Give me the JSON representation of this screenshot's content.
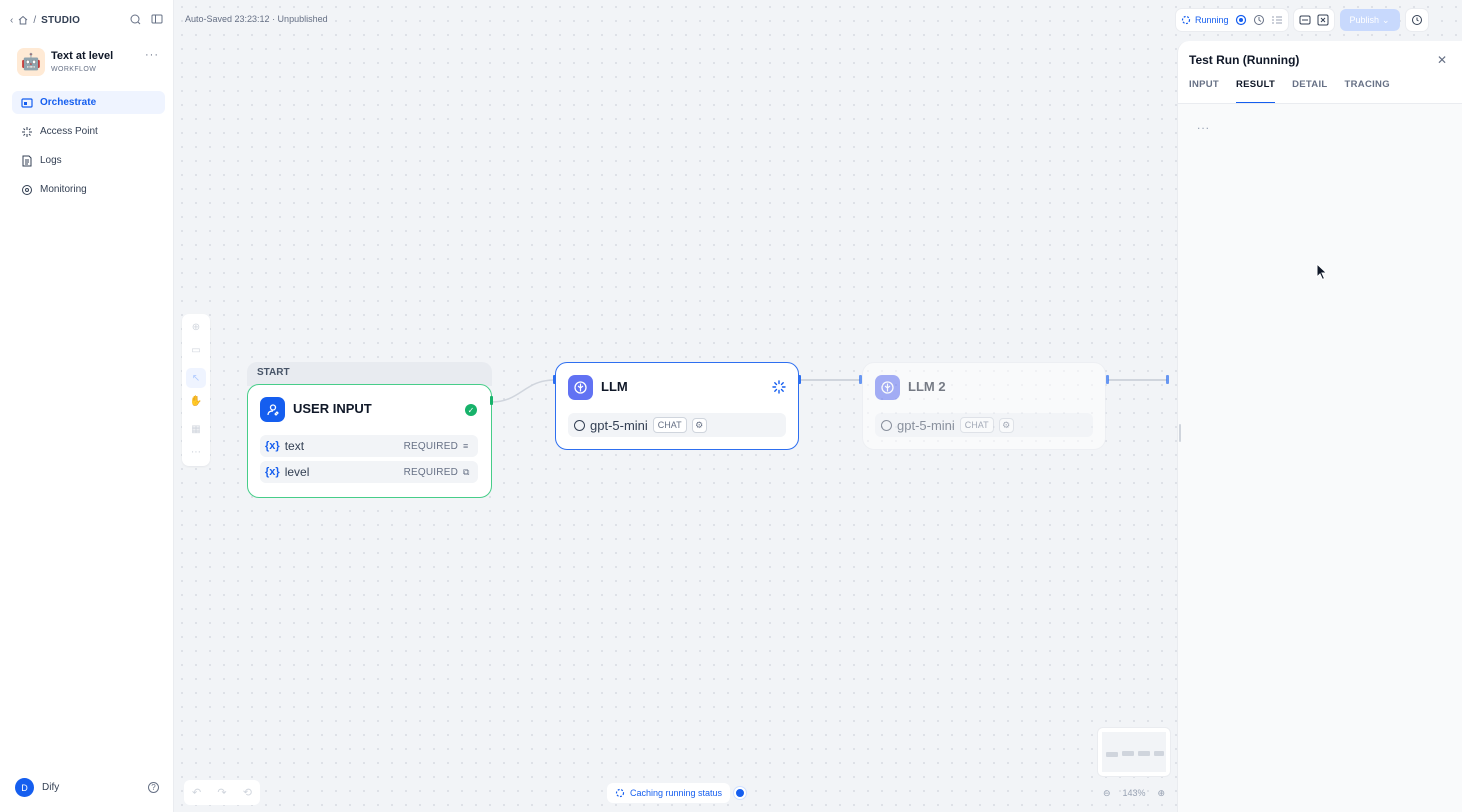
{
  "breadcrumb": {
    "root": "STUDIO"
  },
  "app": {
    "name": "Text at level",
    "type": "WORKFLOW",
    "avatar_emoji": "🤖"
  },
  "nav": [
    {
      "label": "Orchestrate",
      "active": true
    },
    {
      "label": "Access Point",
      "active": false
    },
    {
      "label": "Logs",
      "active": false
    },
    {
      "label": "Monitoring",
      "active": false
    }
  ],
  "user": {
    "initial": "D",
    "name": "Dify"
  },
  "canvas": {
    "status": "Auto-Saved 23:23:12 · Unpublished"
  },
  "toolbar": {
    "running_label": "Running",
    "publish_label": "Publish"
  },
  "nodes": {
    "start_tag": "START",
    "user_input": {
      "title": "USER INPUT",
      "vars": [
        {
          "prefix": "{x}",
          "name": "text",
          "required": "REQUIRED"
        },
        {
          "prefix": "{x}",
          "name": "level",
          "required": "REQUIRED"
        }
      ]
    },
    "llm1": {
      "title": "LLM",
      "model": "gpt-5-mini",
      "mode": "CHAT"
    },
    "llm2": {
      "title": "LLM 2",
      "model": "gpt-5-mini",
      "mode": "CHAT"
    }
  },
  "panel": {
    "title": "Test Run (Running)",
    "tabs": [
      "INPUT",
      "RESULT",
      "DETAIL",
      "TRACING"
    ],
    "active_tab": "RESULT",
    "loading": "..."
  },
  "footer": {
    "caching": "Caching running status",
    "zoom": "143%"
  },
  "colors": {
    "accent": "#155eef",
    "success": "#17b26a",
    "node_border_active": "#2e6ff0"
  }
}
